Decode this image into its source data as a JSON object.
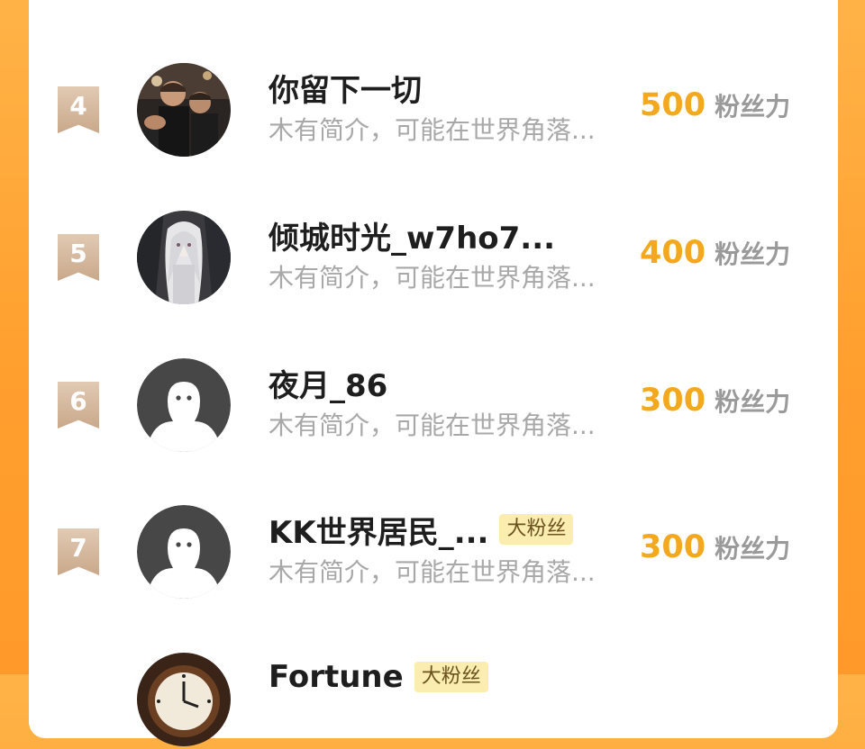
{
  "ranking": {
    "rows": [
      {
        "rank": "4",
        "name": "你留下一切",
        "badge": "",
        "intro": "木有简介，可能在世界角落...",
        "score": "500",
        "unit": "粉丝力",
        "avatar": "photo-group-avatar"
      },
      {
        "rank": "5",
        "name": "倾城时光_w7ho7...",
        "badge": "",
        "intro": "木有简介，可能在世界角落...",
        "score": "400",
        "unit": "粉丝力",
        "avatar": "anime-girl-avatar"
      },
      {
        "rank": "6",
        "name": "夜月_86",
        "badge": "",
        "intro": "木有简介，可能在世界角落...",
        "score": "300",
        "unit": "粉丝力",
        "avatar": "default-user-avatar"
      },
      {
        "rank": "7",
        "name": "KK世界居民_...",
        "badge": "大粉丝",
        "intro": "木有简介，可能在世界角落...",
        "score": "300",
        "unit": "粉丝力",
        "avatar": "default-user-avatar"
      },
      {
        "rank": "",
        "name": "Fortune",
        "badge": "大粉丝",
        "intro": "",
        "score": "",
        "unit": "",
        "avatar": "clock-avatar"
      }
    ]
  },
  "colors": {
    "background": "#ff9f2e",
    "score": "#f4a81e",
    "rank_ribbon": "#c9a88a",
    "badge_bg": "#fbedb0"
  }
}
